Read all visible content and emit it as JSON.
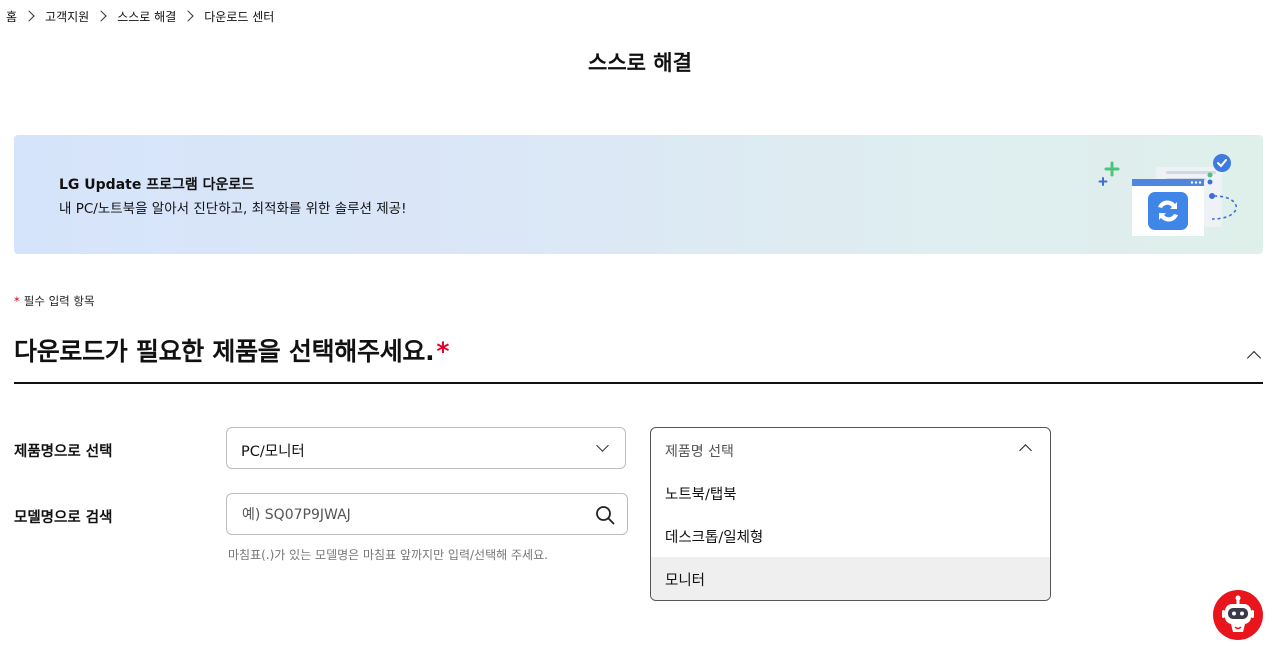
{
  "breadcrumb": [
    "홈",
    "고객지원",
    "스스로 해결",
    "다운로드 센터"
  ],
  "page_title": "스스로 해결",
  "banner": {
    "title": "LG Update 프로그램 다운로드",
    "description": "내 PC/노트북을 알아서 진단하고, 최적화를 위한 솔루션 제공!"
  },
  "required_note": {
    "star": "*",
    "text": "필수 입력 항목"
  },
  "section": {
    "title": "다운로드가 필요한 제품을 선택해주세요.",
    "star": "*"
  },
  "product_select": {
    "label": "제품명으로 선택",
    "category_value": "PC/모니터",
    "product_placeholder": "제품명 선택",
    "options": [
      "노트북/탭북",
      "데스크톱/일체형",
      "모니터"
    ],
    "highlighted_option": "모니터"
  },
  "model_search": {
    "label": "모델명으로 검색",
    "placeholder": "예) SQ07P9JWAJ",
    "helper": "마침표(.)가 있는 모델명은 마침표 앞까지만 입력/선택해 주세요."
  },
  "colors": {
    "accent_red": "#e2002d",
    "chatbot_red": "#e8161c",
    "banner_blue": "#d6e4fb"
  },
  "icons": [
    "chevron-right-icon",
    "chevron-up-icon",
    "chevron-down-icon",
    "search-icon",
    "update-app-icon",
    "chatbot-icon"
  ]
}
